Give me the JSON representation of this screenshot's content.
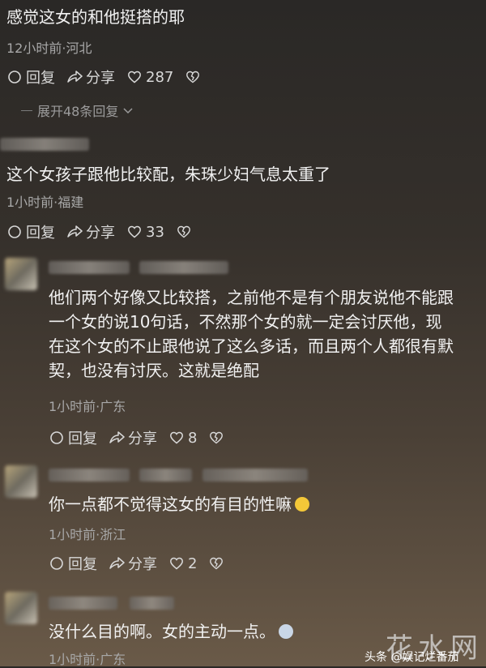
{
  "comments": [
    {
      "text": "感觉这女的和他挺搭的耶",
      "meta": "12小时前·河北",
      "reply": "回复",
      "share": "分享",
      "likes": "287",
      "expand": "展开48条回复"
    },
    {
      "text": "这个女孩子跟他比较配，朱珠少妇气息太重了",
      "meta": "1小时前·福建",
      "reply": "回复",
      "share": "分享",
      "likes": "33"
    },
    {
      "lines": [
        "他们两个好像又比较搭，之前他不是有个朋友说他不能跟",
        "一个女的说10句话，不然那个女的就一定会讨厌他，现",
        "在这个女的不止跟他说了这么多话，而且两个人都很有默",
        "契，也没有讨厌。这就是绝配"
      ],
      "meta": "1小时前·广东",
      "reply": "回复",
      "share": "分享",
      "likes": "8"
    },
    {
      "text": "你一点都不觉得这女的有目的性嘛",
      "meta": "1小时前·浙江",
      "reply": "回复",
      "share": "分享",
      "likes": "2"
    },
    {
      "text": "没什么目的啊。女的主动一点。",
      "meta": "1小时前·广东"
    }
  ],
  "watermark": {
    "logo": "花水网",
    "text": "头条 @娱记烂番茄"
  },
  "colors": {
    "like": "#d9d9d9",
    "meta": "#a8a8a8"
  }
}
